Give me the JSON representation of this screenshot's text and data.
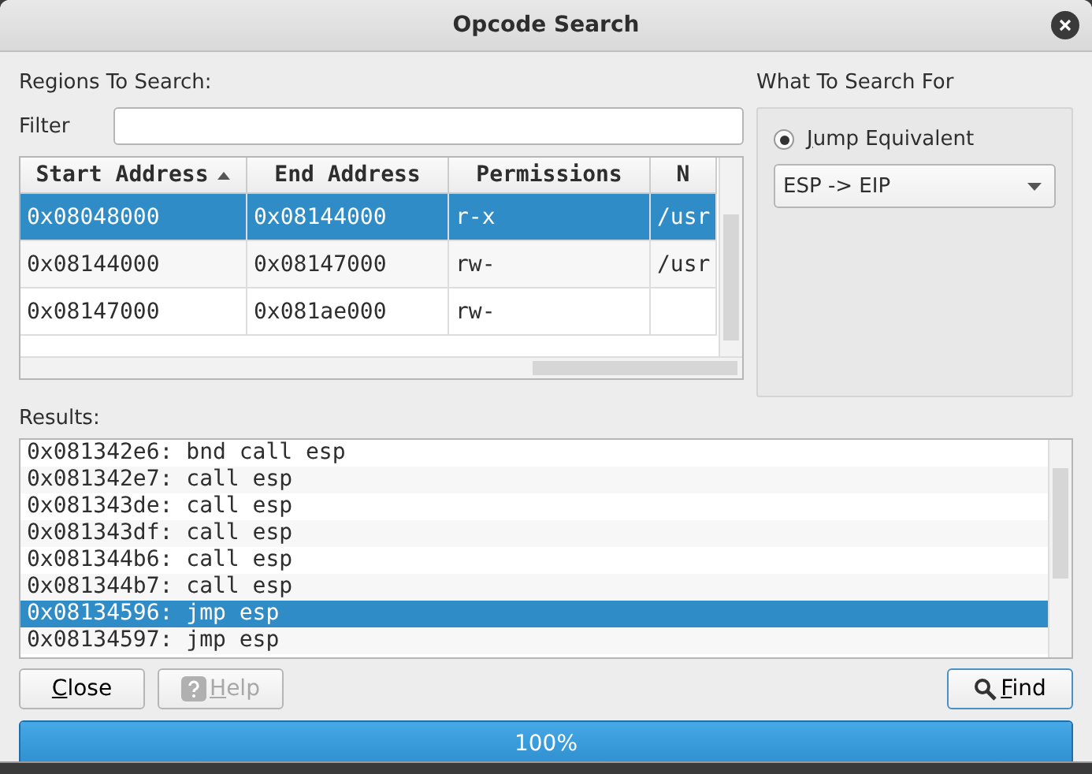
{
  "window": {
    "title": "Opcode Search"
  },
  "regions": {
    "label": "Regions To Search:",
    "filter": {
      "label": "Filter"
    },
    "table": {
      "columns": [
        {
          "label": "Start Address",
          "sorted": true
        },
        {
          "label": "End Address",
          "sorted": false
        },
        {
          "label": "Permissions",
          "sorted": false
        },
        {
          "label": "N",
          "sorted": false
        }
      ],
      "rows": [
        {
          "cells": [
            "0x08048000",
            "0x08144000",
            "r-x",
            "/usr"
          ],
          "selected": true
        },
        {
          "cells": [
            "0x08144000",
            "0x08147000",
            "rw-",
            "/usr"
          ],
          "selected": false
        },
        {
          "cells": [
            "0x08147000",
            "0x081ae000",
            "rw-",
            ""
          ],
          "selected": false
        }
      ]
    }
  },
  "search_for": {
    "label": "What To Search For",
    "options": [
      {
        "label": "Jump Equivalent",
        "selected": true
      }
    ],
    "dropdown": {
      "value": "ESP -> EIP"
    }
  },
  "results": {
    "label": "Results:",
    "items": [
      {
        "text": "0x081342e6: bnd call esp",
        "selected": false
      },
      {
        "text": "0x081342e7: call esp",
        "selected": false
      },
      {
        "text": "0x081343de: call esp",
        "selected": false
      },
      {
        "text": "0x081343df: call esp",
        "selected": false
      },
      {
        "text": "0x081344b6: call esp",
        "selected": false
      },
      {
        "text": "0x081344b7: call esp",
        "selected": false
      },
      {
        "text": "0x08134596: jmp esp",
        "selected": true
      },
      {
        "text": "0x08134597: jmp esp",
        "selected": false
      }
    ]
  },
  "buttons": [
    {
      "kind": "close",
      "label": "Close",
      "disabled": false
    },
    {
      "kind": "help",
      "label": "Help",
      "disabled": true
    },
    {
      "kind": "find",
      "label": "Find",
      "disabled": false
    }
  ],
  "progress": {
    "level": 1,
    "text": "100%"
  }
}
